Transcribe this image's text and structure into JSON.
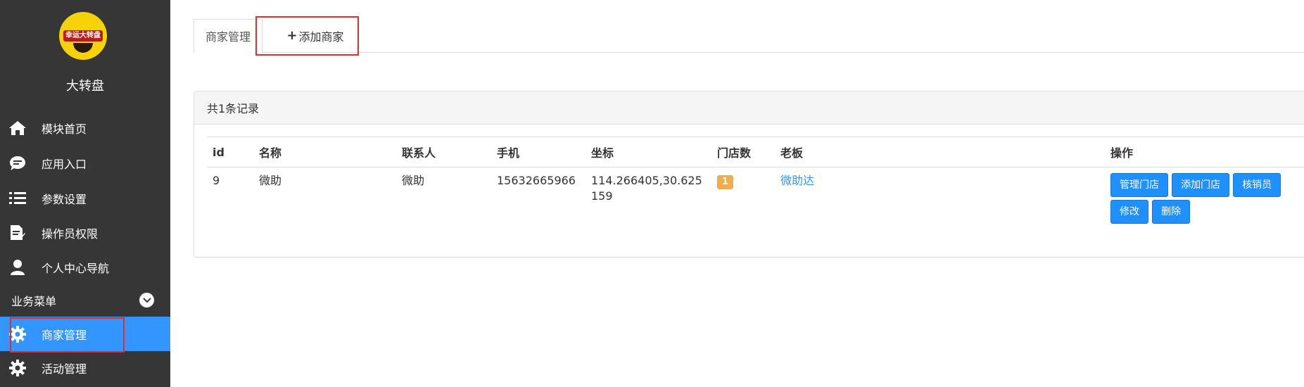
{
  "sidebar": {
    "logo_text": "幸运大转盘",
    "app_name": "大转盘",
    "items": [
      {
        "label": "模块首页",
        "icon": "home-icon"
      },
      {
        "label": "应用入口",
        "icon": "chat-icon"
      },
      {
        "label": "参数设置",
        "icon": "list-icon"
      },
      {
        "label": "操作员权限",
        "icon": "document-edit-icon"
      },
      {
        "label": "个人中心导航",
        "icon": "user-icon"
      }
    ],
    "section_title": "业务菜单",
    "section_items": [
      {
        "label": "商家管理",
        "icon": "gear-icon",
        "active": true
      },
      {
        "label": "活动管理",
        "icon": "gear-icon",
        "active": false
      }
    ]
  },
  "tabs": {
    "manage": "商家管理",
    "add_plus": "+",
    "add": "添加商家"
  },
  "panel": {
    "heading": "共1条记录",
    "columns": [
      "id",
      "名称",
      "联系人",
      "手机",
      "坐标",
      "门店数",
      "老板",
      "操作"
    ],
    "rows": [
      {
        "id": "9",
        "name": "微助",
        "contact": "微助",
        "phone": "15632665966",
        "coords": "114.266405,30.625159",
        "store_count": "1",
        "boss": "微助达",
        "actions": [
          "管理门店",
          "添加门店",
          "核销员",
          "修改",
          "删除"
        ]
      }
    ]
  },
  "colors": {
    "sidebar_bg": "#363636",
    "active_bg": "#3396ff",
    "button_bg": "#1e90ff",
    "badge_bg": "#f0ad4e",
    "highlight_border": "#e02e2e"
  }
}
